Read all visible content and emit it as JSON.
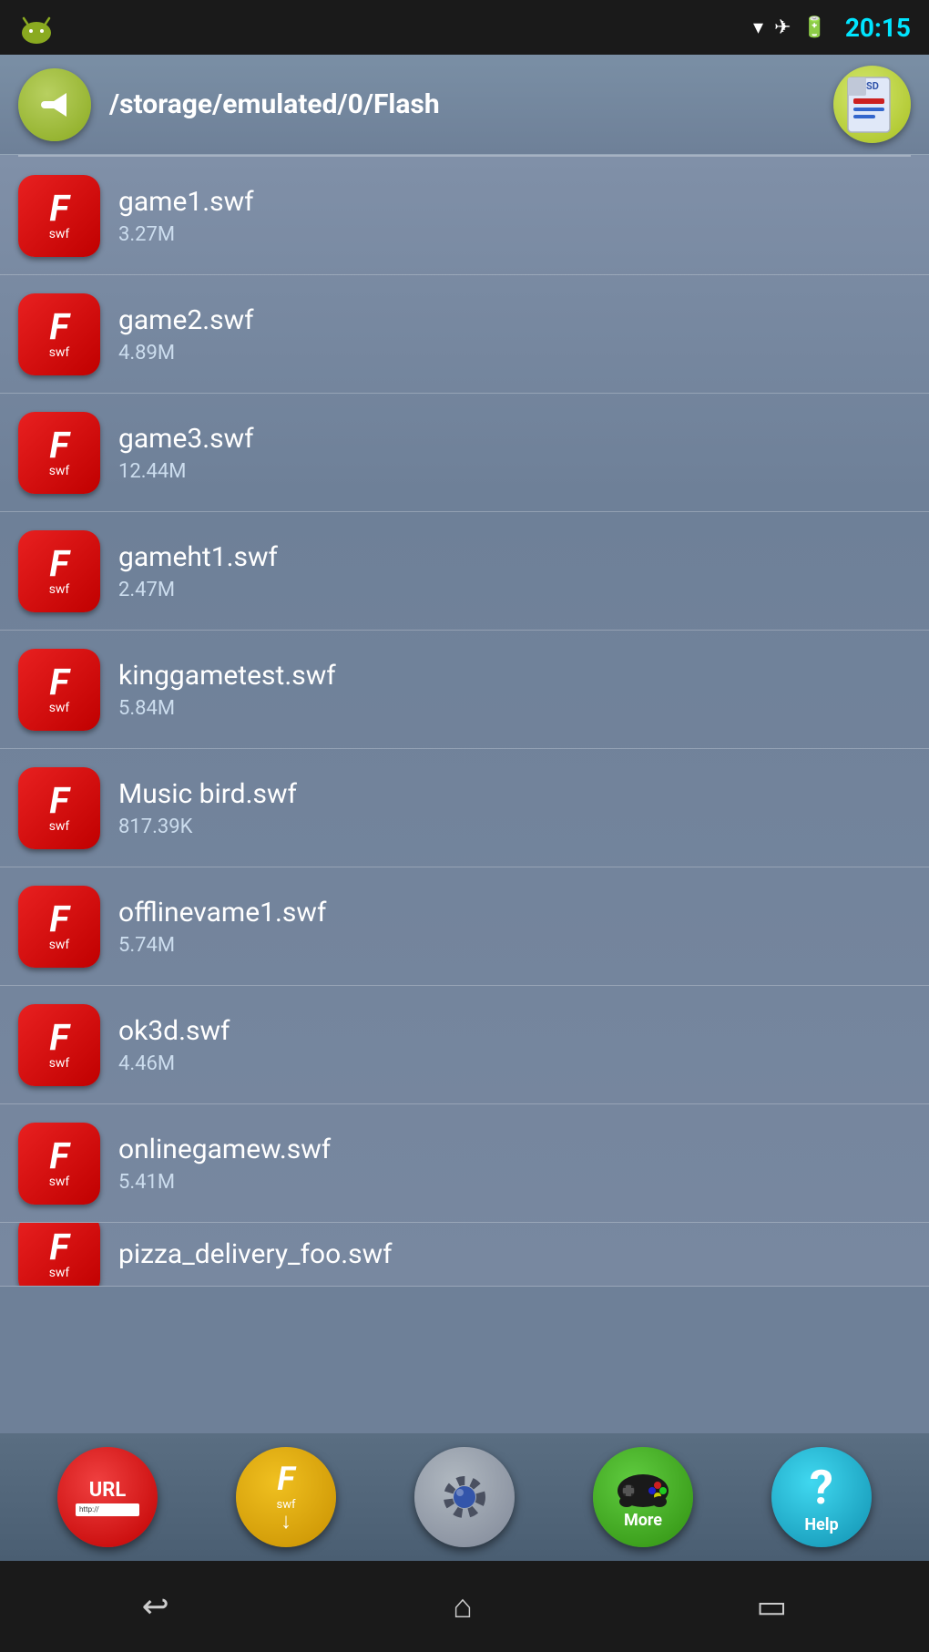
{
  "statusBar": {
    "time": "20:15"
  },
  "header": {
    "path": "/storage/emulated/0/Flash",
    "backLabel": "back",
    "sdLabel": "SD"
  },
  "files": [
    {
      "name": "game1.swf",
      "size": "3.27M"
    },
    {
      "name": "game2.swf",
      "size": "4.89M"
    },
    {
      "name": "game3.swf",
      "size": "12.44M"
    },
    {
      "name": "gameht1.swf",
      "size": "2.47M"
    },
    {
      "name": "kinggametest.swf",
      "size": "5.84M"
    },
    {
      "name": "Music bird.swf",
      "size": "817.39K"
    },
    {
      "name": "offlinevame1.swf",
      "size": "5.74M"
    },
    {
      "name": "ok3d.swf",
      "size": "4.46M"
    },
    {
      "name": "onlinegamew.swf",
      "size": "5.41M"
    },
    {
      "name": "pizza_delivery_foo.swf",
      "size": ""
    }
  ],
  "nav": {
    "url": {
      "label": "URL",
      "sublabel": "http://"
    },
    "flash": {
      "label": "F",
      "sublabel": "swf"
    },
    "settings": {
      "label": "Settings"
    },
    "more": {
      "label": "More"
    },
    "help": {
      "label": "Help"
    }
  },
  "systemBar": {
    "back": "↩",
    "home": "⌂",
    "recents": "▭"
  }
}
